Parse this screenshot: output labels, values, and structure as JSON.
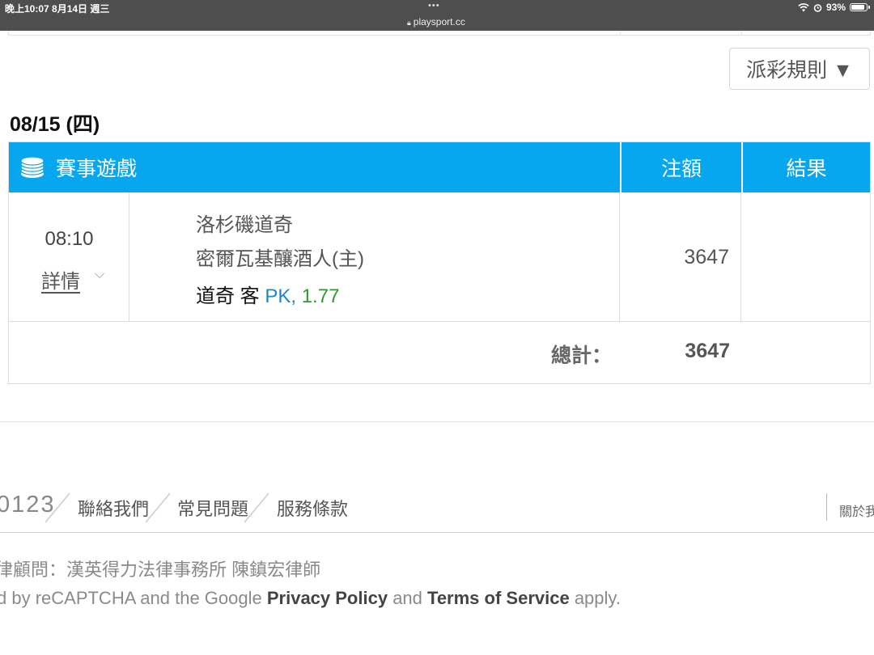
{
  "status_bar": {
    "time_date": "晚上10:07  8月14日 週三",
    "dots": "•••",
    "url": "playsport.cc",
    "battery": "93%",
    "battery_level": 0.93
  },
  "rules_button": {
    "label": "派彩規則 ▼"
  },
  "date_heading": "08/15 (四)",
  "table": {
    "headers": {
      "game": "賽事遊戲",
      "bet": "注額",
      "result": "結果"
    },
    "rows": [
      {
        "time": "08:10",
        "detail_label": "詳情",
        "away_team": "洛杉磯道奇",
        "home_team": "密爾瓦基釀酒人(主)",
        "pick_team": "道奇 客",
        "pick_type": "PK,",
        "pick_odds": "1.77",
        "bet_amount": "3647",
        "result": ""
      }
    ],
    "total_label": "總計：",
    "total_amount": "3647"
  },
  "footer": {
    "code": "0123",
    "links": [
      "聯絡我們",
      "常見問題",
      "服務條款"
    ],
    "about": "關於我",
    "legal_advisor": "律顧問：漢英得力法律事務所 陳鎮宏律師",
    "recaptcha": {
      "prefix": "d by reCAPTCHA and the Google ",
      "privacy": "Privacy Policy",
      "and": " and ",
      "terms": "Terms of Service",
      "suffix": " apply."
    }
  },
  "colors": {
    "header_blue": "#06a7ef",
    "pk_blue": "#1b87c9",
    "odds_green": "#2e9a2e"
  }
}
